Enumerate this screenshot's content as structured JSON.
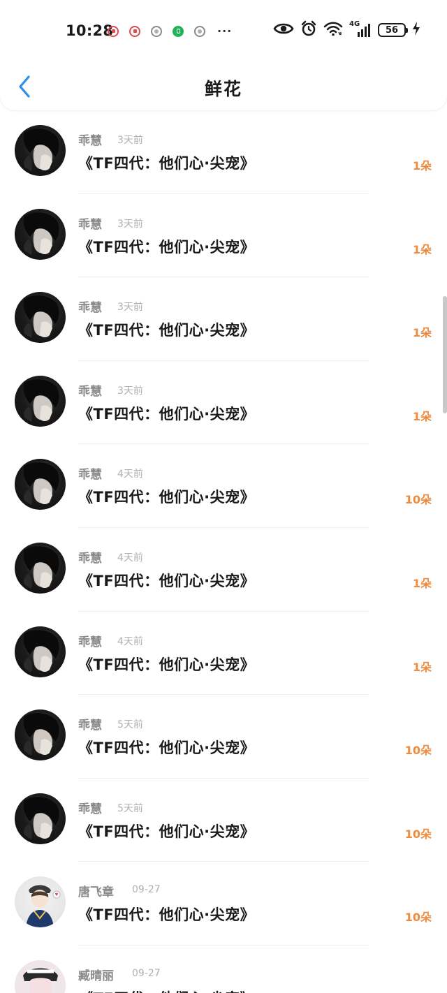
{
  "status_bar": {
    "time": "10:28",
    "notification_icons": [
      "red-app-icon",
      "red-app-icon",
      "gray-app-icon",
      "green-app-icon",
      "gray-app-icon"
    ],
    "more": "···",
    "network": "4G",
    "battery": "56"
  },
  "header": {
    "title": "鲜花"
  },
  "colors": {
    "accent_orange": "#f08a3c",
    "back_blue": "#2b8fe8"
  },
  "items": [
    {
      "name": "乖慧",
      "time": "3天前",
      "title": "《TF四代：他们心·尖宠》",
      "count": "1朵",
      "avatar": "dark-portrait-avatar"
    },
    {
      "name": "乖慧",
      "time": "3天前",
      "title": "《TF四代：他们心·尖宠》",
      "count": "1朵",
      "avatar": "dark-portrait-avatar"
    },
    {
      "name": "乖慧",
      "time": "3天前",
      "title": "《TF四代：他们心·尖宠》",
      "count": "1朵",
      "avatar": "dark-portrait-avatar"
    },
    {
      "name": "乖慧",
      "time": "3天前",
      "title": "《TF四代：他们心·尖宠》",
      "count": "1朵",
      "avatar": "dark-portrait-avatar"
    },
    {
      "name": "乖慧",
      "time": "4天前",
      "title": "《TF四代：他们心·尖宠》",
      "count": "10朵",
      "avatar": "dark-portrait-avatar"
    },
    {
      "name": "乖慧",
      "time": "4天前",
      "title": "《TF四代：他们心·尖宠》",
      "count": "1朵",
      "avatar": "dark-portrait-avatar"
    },
    {
      "name": "乖慧",
      "time": "4天前",
      "title": "《TF四代：他们心·尖宠》",
      "count": "1朵",
      "avatar": "dark-portrait-avatar"
    },
    {
      "name": "乖慧",
      "time": "5天前",
      "title": "《TF四代：他们心·尖宠》",
      "count": "10朵",
      "avatar": "dark-portrait-avatar"
    },
    {
      "name": "乖慧",
      "time": "5天前",
      "title": "《TF四代：他们心·尖宠》",
      "count": "10朵",
      "avatar": "dark-portrait-avatar"
    },
    {
      "name": "唐飞章",
      "time": "09-27",
      "title": "《TF四代：他们心·尖宠》",
      "count": "10朵",
      "avatar": "cartoon-boy-avatar"
    },
    {
      "name": "臧晴丽",
      "time": "09-27",
      "title": "《TF四代：他们心·尖宠》",
      "count": "",
      "avatar": "cartoon-girl-avatar"
    }
  ]
}
